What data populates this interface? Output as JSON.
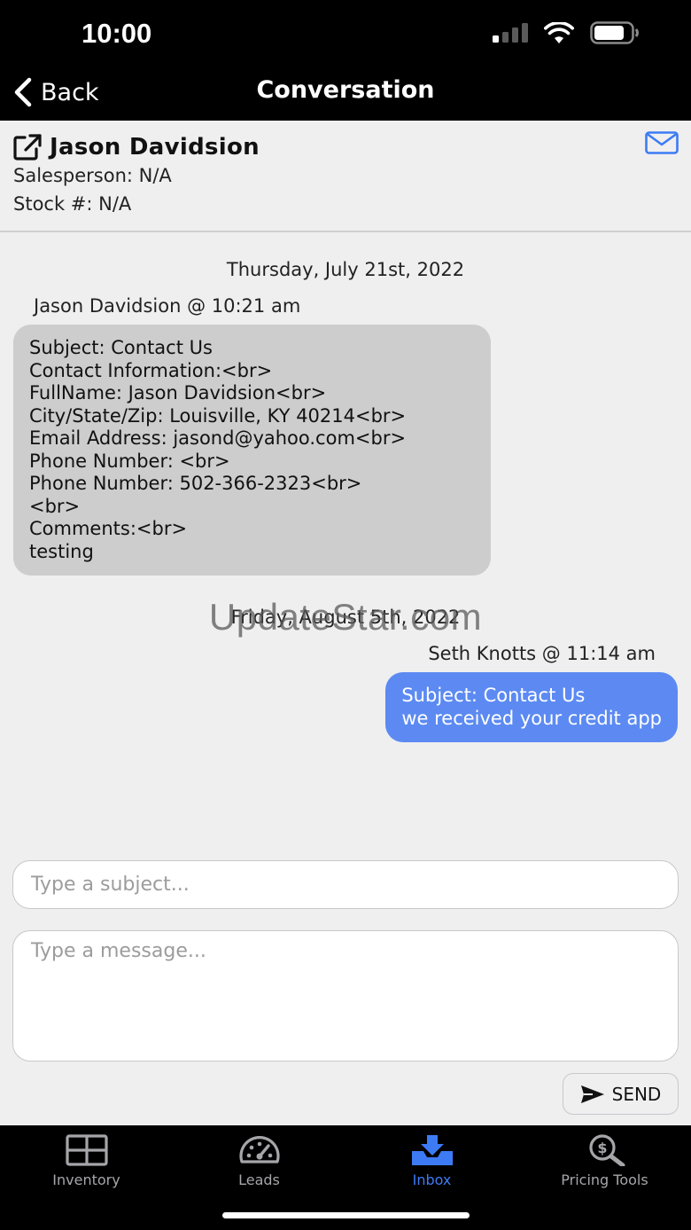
{
  "status_bar": {
    "time": "10:00"
  },
  "nav": {
    "back_label": "Back",
    "title": "Conversation"
  },
  "contact": {
    "name": "Jason Davidsion",
    "salesperson": "Salesperson: N/A",
    "stock": "Stock #: N/A"
  },
  "messages": [
    {
      "date": "Thursday, July 21st, 2022",
      "sender": "Jason Davidsion @ 10:21 am",
      "direction": "incoming",
      "lines": [
        "Subject: Contact Us",
        "Contact Information:<br>",
        "FullName: Jason Davidsion<br>",
        "City/State/Zip: Louisville, KY 40214<br>",
        "Email Address: jasond@yahoo.com<br>",
        "Phone Number: <br>",
        "Phone Number: 502-366-2323<br>",
        "<br>",
        "Comments:<br>",
        "testing"
      ]
    },
    {
      "date": "Friday, August 5th, 2022",
      "sender": "Seth Knotts @ 11:14 am",
      "direction": "outgoing",
      "lines": [
        "Subject: Contact Us",
        "we received your credit app"
      ]
    }
  ],
  "watermark": "UpdateStar.com",
  "composer": {
    "subject_placeholder": "Type a subject...",
    "message_placeholder": "Type a message...",
    "send_label": "SEND"
  },
  "tabs": [
    {
      "label": "Inventory",
      "icon": "grid-icon",
      "active": false
    },
    {
      "label": "Leads",
      "icon": "speedometer-icon",
      "active": false
    },
    {
      "label": "Inbox",
      "icon": "inbox-download-icon",
      "active": true
    },
    {
      "label": "Pricing Tools",
      "icon": "dollar-search-icon",
      "active": false
    }
  ],
  "colors": {
    "accent": "#3d7bf5",
    "outgoing_bubble": "#5c8af2",
    "incoming_bubble": "#cdcdcd",
    "background": "#efeff0",
    "bars": "#000000"
  }
}
